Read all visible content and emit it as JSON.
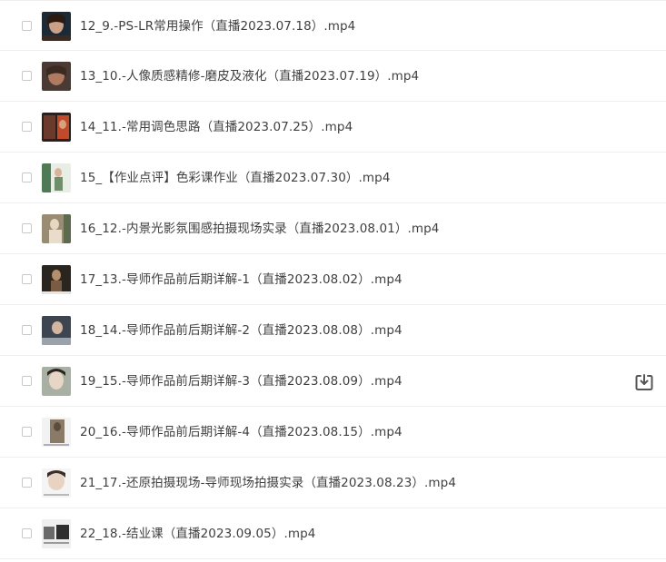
{
  "files": [
    {
      "name": "12_9.-PS-LR常用操作（直播2023.07.18）.mp4",
      "thumb_bg": "#1c2a35",
      "thumb_fg": "#c9a088"
    },
    {
      "name": "13_10.-人像质感精修-磨皮及液化（直播2023.07.19）.mp4",
      "thumb_bg": "#4a3a33",
      "thumb_fg": "#b07a60"
    },
    {
      "name": "14_11.-常用调色思路（直播2023.07.25）.mp4",
      "thumb_bg": "#2a1f1c",
      "thumb_fg": "#c14a2a"
    },
    {
      "name": "15_【作业点评】色彩课作业（直播2023.07.30）.mp4",
      "thumb_bg": "#e8ede6",
      "thumb_fg": "#4e7a55"
    },
    {
      "name": "16_12.-内景光影氛围感拍摄现场实录（直播2023.08.01）.mp4",
      "thumb_bg": "#9a8c72",
      "thumb_fg": "#e6d7c2"
    },
    {
      "name": "17_13.-导师作品前后期详解-1（直播2023.08.02）.mp4",
      "thumb_bg": "#2b2520",
      "thumb_fg": "#b58e6c"
    },
    {
      "name": "18_14.-导师作品前后期详解-2（直播2023.08.08）.mp4",
      "thumb_bg": "#3d4650",
      "thumb_fg": "#9aa3ab"
    },
    {
      "name": "19_15.-导师作品前后期详解-3（直播2023.08.09）.mp4",
      "thumb_bg": "#a8b0a3",
      "thumb_fg": "#e7d5c6"
    },
    {
      "name": "20_16.-导师作品前后期详解-4（直播2023.08.15）.mp4",
      "thumb_bg": "#f2f2f2",
      "thumb_fg": "#5a4c3e"
    },
    {
      "name": "21_17.-还原拍摄现场-导师现场拍摄实录（直播2023.08.23）.mp4",
      "thumb_bg": "#f4f4f4",
      "thumb_fg": "#c9b6a8"
    },
    {
      "name": "22_18.-结业课（直播2023.09.05）.mp4",
      "thumb_bg": "#efefef",
      "thumb_fg": "#2f2f2f"
    }
  ],
  "download_icon": "download-tray-icon",
  "colors": {
    "text": "#3f3f3f",
    "divider": "#eeeeee",
    "checkbox_border": "#c9c9c9",
    "icon": "#555555"
  }
}
